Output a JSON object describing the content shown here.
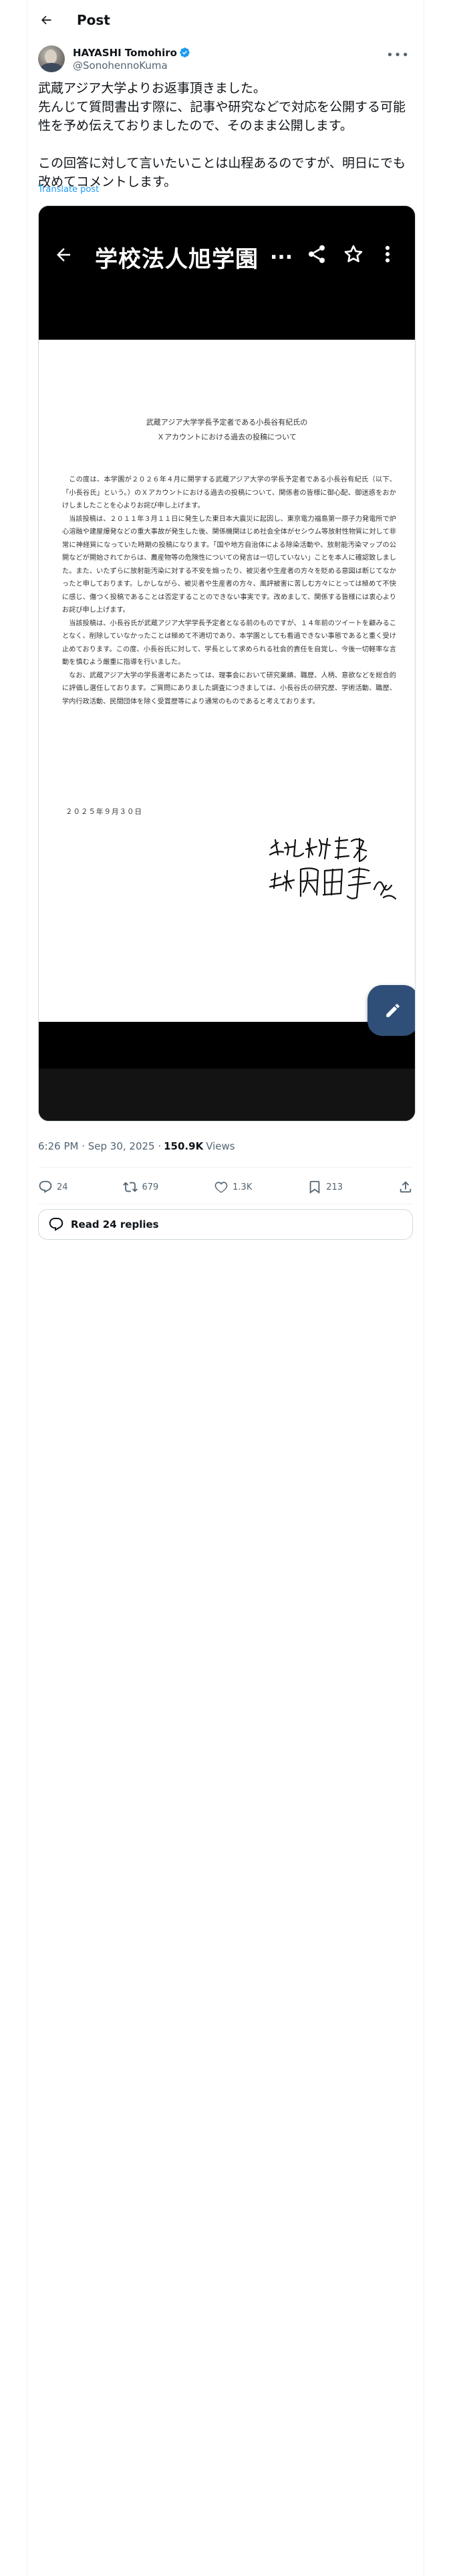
{
  "header": {
    "title": "Post"
  },
  "author": {
    "name": "HAYASHI Tomohiro",
    "handle": "@SonohennoKuma",
    "verified_color": "#1d9bf0"
  },
  "tweet": {
    "text": "武蔵アジア大学よりお返事頂きました。\n先んじて質問書出す際に、記事や研究などで対応を公開する可能性を予め伝えておりましたので、そのまま公開します。\n\nこの回答に対して言いたいことは山程あるのですが、明日にでも改めてコメントします。",
    "translate_label": "Translate post"
  },
  "media": {
    "app_title": "学校法人旭学園",
    "app_dots": "...",
    "document": {
      "title": "武蔵アジア大学学長予定者である小長谷有紀氏の\nＸアカウントにおける過去の投稿について",
      "paragraphs": [
        "この度は、本学園が２０２６年４月に開学する武蔵アジア大学の学長予定者である小長谷有紀氏（以下、「小長谷氏」という。）のＸアカウントにおける過去の投稿について、関係者の皆様に御心配、御迷惑をおかけしましたことを心よりお詫び申し上げます。",
        "当該投稿は、２０１１年３月１１日に発生した東日本大震災に起因し、東京電力福島第一原子力発電所で炉心溶融や建屋爆発などの重大事故が発生した後、関係機関はじめ社会全体がセシウム等放射性物質に対して非常に神経質になっていた時期の投稿になります。「国や地方自治体による除染活動や、放射能汚染マップの公開などが開始されてからは、農産物等の危険性についての発言は一切していない」ことを本人に確認致しました。また、いたずらに放射能汚染に対する不安を煽ったり、被災者や生産者の方々を貶める意図は断じてなかったと申しております。しかしながら、被災者や生産者の方々、風評被害に苦しむ方々にとっては極めて不快に感じ、傷つく投稿であることは否定することのできない事実です。改めまして、関係する皆様には衷心よりお詫び申し上げます。",
        "当該投稿は、小長谷氏が武蔵アジア大学学長予定者となる前のものですが、１４年前のツイートを顧みることなく、削除していなかったことは極めて不適切であり、本学園としても看過できない事態であると重く受け止めております。この度、小長谷氏に対して、学長として求められる社会的責任を自覚し、今後一切軽率な言動を慎むよう厳重に指導を行いました。",
        "なお、武蔵アジア大学の学長選考にあたっては、理事会において研究業績、職歴、人柄、意欲などを総合的に評価し選任しております。ご質問にありました調査につきましては、小長谷氏の研究歴、学術活動、職歴、学内行政活動、民間団体を除く受賞歴等により通常のものであると考えております。"
      ],
      "date": "２０２５年９月３０日",
      "signature_org": "学校法人 旭学園",
      "signature_name": "理事長 内田信子 (印)"
    }
  },
  "meta": {
    "time": "6:26 PM · Sep 30, 2025 · ",
    "views_count": "150.9K",
    "views_label": "Views"
  },
  "actions": {
    "replies": "24",
    "reposts": "679",
    "likes": "1.3K",
    "bookmarks": "213"
  },
  "read_replies": {
    "label": "Read 24 replies"
  }
}
